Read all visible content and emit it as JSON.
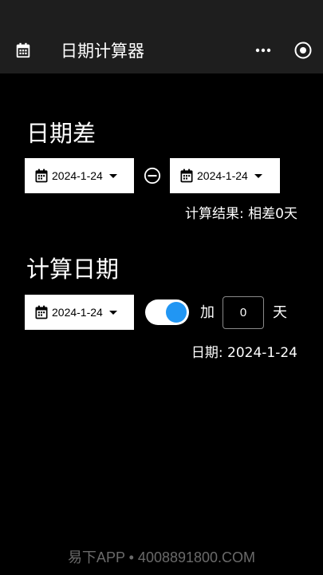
{
  "header": {
    "title": "日期计算器",
    "app_icon": "calendar-icon",
    "menu_icon": "more-horizontal-icon",
    "target_icon": "target-icon"
  },
  "date_diff": {
    "title": "日期差",
    "start_date": "2024-1-24",
    "end_date": "2024-1-24",
    "operator_icon": "minus-circle-icon",
    "result": "计算结果: 相差0天"
  },
  "date_calc": {
    "title": "计算日期",
    "base_date": "2024-1-24",
    "add_enabled": true,
    "add_label": "加",
    "days_value": "0",
    "day_unit": "天",
    "result": "日期: 2024-1-24"
  },
  "watermark": "易下APP • 4008891800.COM",
  "colors": {
    "header_bg": "#1e1e1e",
    "background": "#000000",
    "toggle_knob": "#2196f3"
  }
}
